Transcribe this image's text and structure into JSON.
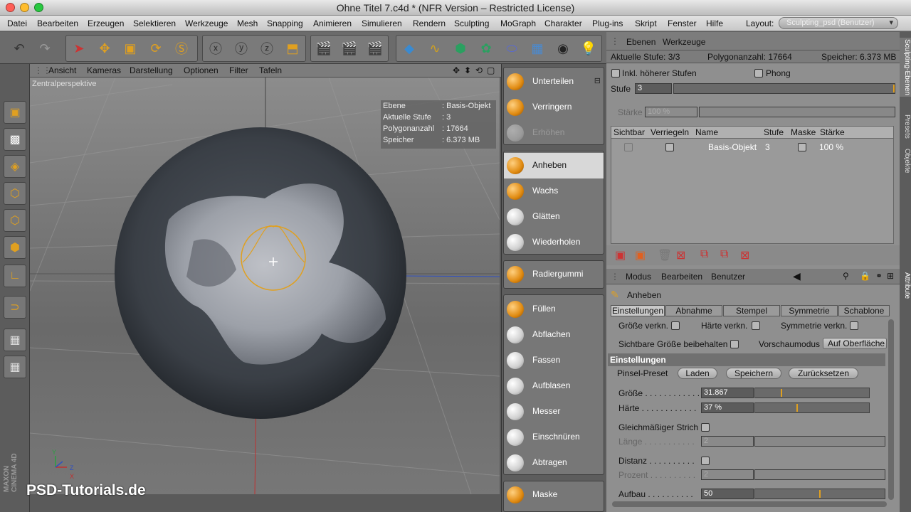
{
  "window": {
    "title": "Ohne Titel 7.c4d * (NFR Version – Restricted License)"
  },
  "menu": {
    "items": [
      "Datei",
      "Bearbeiten",
      "Erzeugen",
      "Selektieren",
      "Werkzeuge",
      "Mesh",
      "Snapping",
      "Animieren",
      "Simulieren",
      "Rendern",
      "Sculpting",
      "MoGraph",
      "Charakter",
      "Plug-ins",
      "Skript",
      "Fenster",
      "Hilfe"
    ],
    "layout_label": "Layout:",
    "layout_value": "Sculpting_psd (Benutzer)"
  },
  "viewport": {
    "menu": [
      "Ansicht",
      "Kameras",
      "Darstellung",
      "Optionen",
      "Filter",
      "Tafeln"
    ],
    "label": "Zentralperspektive",
    "info": {
      "rows": [
        {
          "k": "Ebene",
          "v": ": Basis-Objekt"
        },
        {
          "k": "Aktuelle Stufe",
          "v": ": 3"
        },
        {
          "k": "Polygonanzahl",
          "v": ": 17664"
        },
        {
          "k": "Speicher",
          "v": ": 6.373 MB"
        }
      ]
    },
    "axes": {
      "y": "Y",
      "z": "Z",
      "x": "X"
    }
  },
  "brushes": {
    "group1": [
      "Unterteilen",
      "Verringern",
      "Erhöhen"
    ],
    "group2": [
      "Anheben",
      "Wachs",
      "Glätten",
      "Wiederholen"
    ],
    "group3": [
      "Radiergummi"
    ],
    "group4": [
      "Füllen",
      "Abflachen",
      "Fassen",
      "Aufblasen",
      "Messer",
      "Einschnüren",
      "Abtragen"
    ],
    "group5": [
      "Maske"
    ],
    "active": "Anheben"
  },
  "layers_panel": {
    "menu": [
      "Ebenen",
      "Werkzeuge"
    ],
    "status": {
      "stufe": "Aktuelle Stufe: 3/3",
      "poly": "Polygonanzahl: 17664",
      "mem": "Speicher: 6.373 MB"
    },
    "incl_label": "Inkl. höherer Stufen",
    "phong_label": "Phong",
    "stufe_label": "Stufe",
    "stufe_value": "3",
    "staerke_label": "Stärke",
    "staerke_value": "100 %",
    "columns": [
      "Sichtbar",
      "Verriegeln",
      "Name",
      "Stufe",
      "Maske",
      "Stärke"
    ],
    "row": {
      "name": "Basis-Objekt",
      "stufe": "3",
      "staerke": "100 %"
    }
  },
  "attr_panel": {
    "menu": [
      "Modus",
      "Bearbeiten",
      "Benutzer"
    ],
    "tool": "Anheben",
    "tabs": [
      "Einstellungen",
      "Abnahme",
      "Stempel",
      "Symmetrie",
      "Schablone"
    ],
    "grosse_verkn": "Größe verkn.",
    "haerte_verkn": "Härte verkn.",
    "sym_verkn": "Symmetrie verkn.",
    "sichtbar": "Sichtbare Größe beibehalten",
    "vorschau_label": "Vorschaumodus",
    "vorschau_value": "Auf Oberfläche",
    "section": "Einstellungen",
    "preset_label": "Pinsel-Preset",
    "btn_laden": "Laden",
    "btn_speichern": "Speichern",
    "btn_reset": "Zurücksetzen",
    "groesse_label": "Größe . . . . . . . . . . . .",
    "groesse_value": "31.867",
    "groesse_level": 0.23,
    "haerte_label": "Härte . . . . . . . . . . . .",
    "haerte_value": "37 %",
    "haerte_level": 0.37,
    "gleich_label": "Gleichmäßiger Strich",
    "laenge_label": "Länge . . . . . . . . . . .",
    "laenge_value": "2",
    "distanz_label": "Distanz . . . . . . . . . .",
    "prozent_label": "Prozent . . . . . . . . . .",
    "prozent_value": "2",
    "aufbau_label": "Aufbau . . . . . . . . . .",
    "aufbau_value": "50",
    "aufbau_level": 0.5
  },
  "side_tabs": [
    "Sculpting-Ebenen",
    "Presets",
    "Objekte",
    "Attribute"
  ],
  "watermark": "PSD-Tutorials.de",
  "maxon": "MAXON CINEMA 4D",
  "colors": {
    "accent": "#e0a020",
    "panel": "#8f8f8f",
    "viewport": "#7a7a7a"
  }
}
